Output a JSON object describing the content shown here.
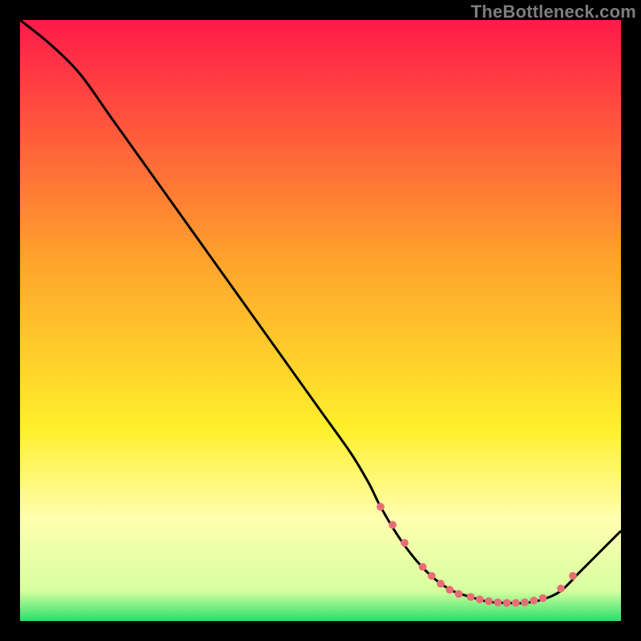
{
  "attribution": "TheBottleneck.com",
  "colors": {
    "top": "#ff1a4a",
    "mid_orange": "#ffa32c",
    "yellow": "#ffef2c",
    "pale_yellow": "#ffffb0",
    "green": "#27e06a",
    "curve": "#000000",
    "dot": "#e86e76"
  },
  "chart_data": {
    "type": "line",
    "title": "",
    "xlabel": "",
    "ylabel": "",
    "xlim": [
      0,
      100
    ],
    "ylim": [
      0,
      100
    ],
    "series": [
      {
        "name": "bottleneck-curve",
        "x": [
          0,
          5,
          10,
          15,
          20,
          25,
          30,
          35,
          40,
          45,
          50,
          55,
          58,
          60,
          63,
          66,
          69,
          72,
          75,
          78,
          81,
          84,
          87,
          90,
          93,
          96,
          100
        ],
        "y": [
          100,
          96,
          91,
          84,
          77,
          70,
          63,
          56,
          49,
          42,
          35,
          28,
          23,
          19,
          14,
          10,
          7,
          5,
          4,
          3.2,
          3,
          3,
          3.6,
          5,
          8,
          11,
          15
        ]
      }
    ],
    "scatter_points": {
      "name": "highlighted-region",
      "x": [
        60,
        62,
        64,
        67,
        68.5,
        70,
        71.5,
        73,
        75,
        76.5,
        78,
        79.5,
        81,
        82.5,
        84,
        85.5,
        87,
        90,
        92
      ],
      "y": [
        19,
        16,
        13,
        9,
        7.5,
        6.2,
        5.2,
        4.5,
        4,
        3.6,
        3.3,
        3.1,
        3,
        3,
        3.1,
        3.4,
        3.8,
        5.4,
        7.5
      ]
    },
    "gradient_stops": [
      {
        "offset": 0.0,
        "color": "#ff1a4a"
      },
      {
        "offset": 0.4,
        "color": "#ffa32c"
      },
      {
        "offset": 0.68,
        "color": "#ffef2c"
      },
      {
        "offset": 0.83,
        "color": "#ffffb0"
      },
      {
        "offset": 0.95,
        "color": "#d7ff9f"
      },
      {
        "offset": 1.0,
        "color": "#27e06a"
      }
    ]
  }
}
